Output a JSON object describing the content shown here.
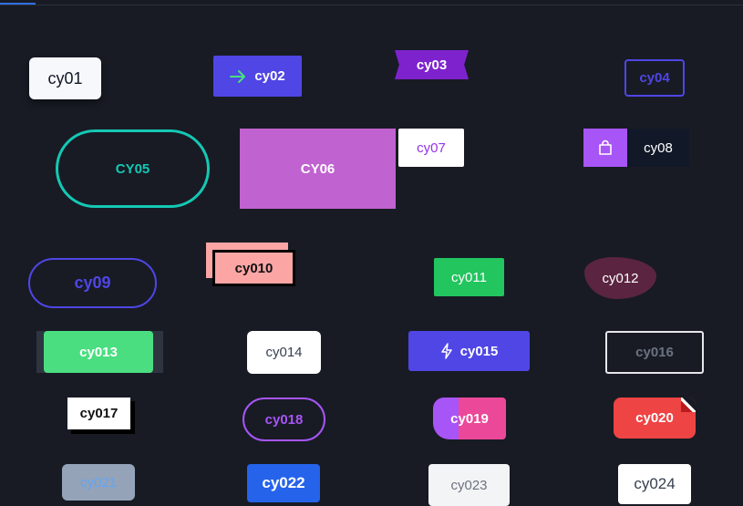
{
  "buttons": {
    "cy01": "cy01",
    "cy02": "cy02",
    "cy03": "cy03",
    "cy04": "cy04",
    "cy05": "CY05",
    "cy06": "CY06",
    "cy07": "cy07",
    "cy08": "cy08",
    "cy09": "cy09",
    "cy010": "cy010",
    "cy011": "cy011",
    "cy012": "cy012",
    "cy013": "cy013",
    "cy014": "cy014",
    "cy015": "cy015",
    "cy016": "cy016",
    "cy017": "cy017",
    "cy018": "cy018",
    "cy019": "cy019",
    "cy020": "cy020",
    "cy021": "cy021",
    "cy022": "cy022",
    "cy023": "cy023",
    "cy024": "cy024"
  },
  "icons": {
    "cy02": "arrow-right-icon",
    "cy08": "shopping-bag-icon",
    "cy015": "lightning-icon"
  },
  "colors": {
    "background": "#181b24",
    "indigo": "#4f46e5",
    "purple": "#7e22ce",
    "teal": "#14c8b4",
    "orchid": "#c062d0",
    "green": "#22c55e",
    "red": "#ef4444",
    "blue": "#2563eb"
  }
}
